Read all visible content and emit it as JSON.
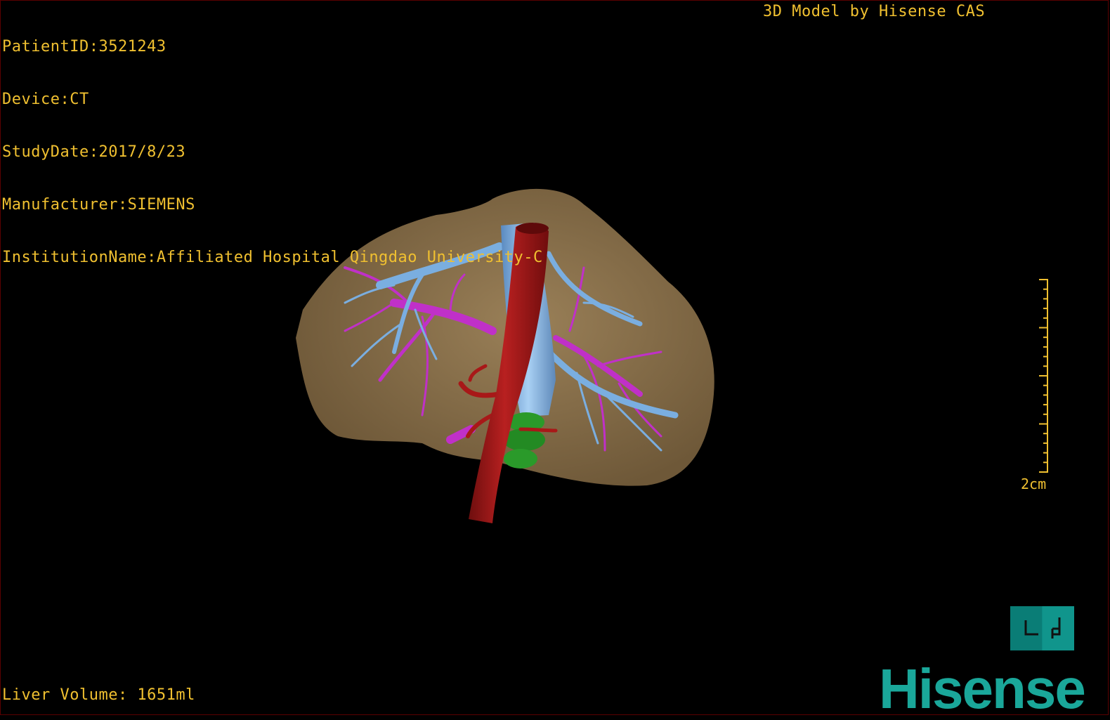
{
  "overlay": {
    "patient_id": "PatientID:3521243",
    "device": "Device:CT",
    "study_date": "StudyDate:2017/8/23",
    "manufacturer": "Manufacturer:SIEMENS",
    "institution": "InstitutionName:Affiliated Hospital Qingdao University-C",
    "credit": "3D Model by Hisense CAS",
    "liver_volume": "Liver Volume: 1651ml"
  },
  "scale_bar": {
    "label": "2cm"
  },
  "orientation_cube": {
    "left_face": "L",
    "right_face": "P"
  },
  "logo": {
    "text": "Hisense"
  },
  "colors": {
    "overlay_text": "#f0c030",
    "liver": "#8a7050",
    "hepatic_vein": "#7aaee0",
    "portal_vein": "#c030c8",
    "artery": "#a81818",
    "green_structure": "#2a9a2a",
    "brand": "#1aa79a"
  },
  "model_structures": [
    "liver",
    "inferior-vena-cava",
    "hepatic-veins",
    "portal-veins",
    "aorta",
    "hepatic-artery",
    "green-structure"
  ]
}
